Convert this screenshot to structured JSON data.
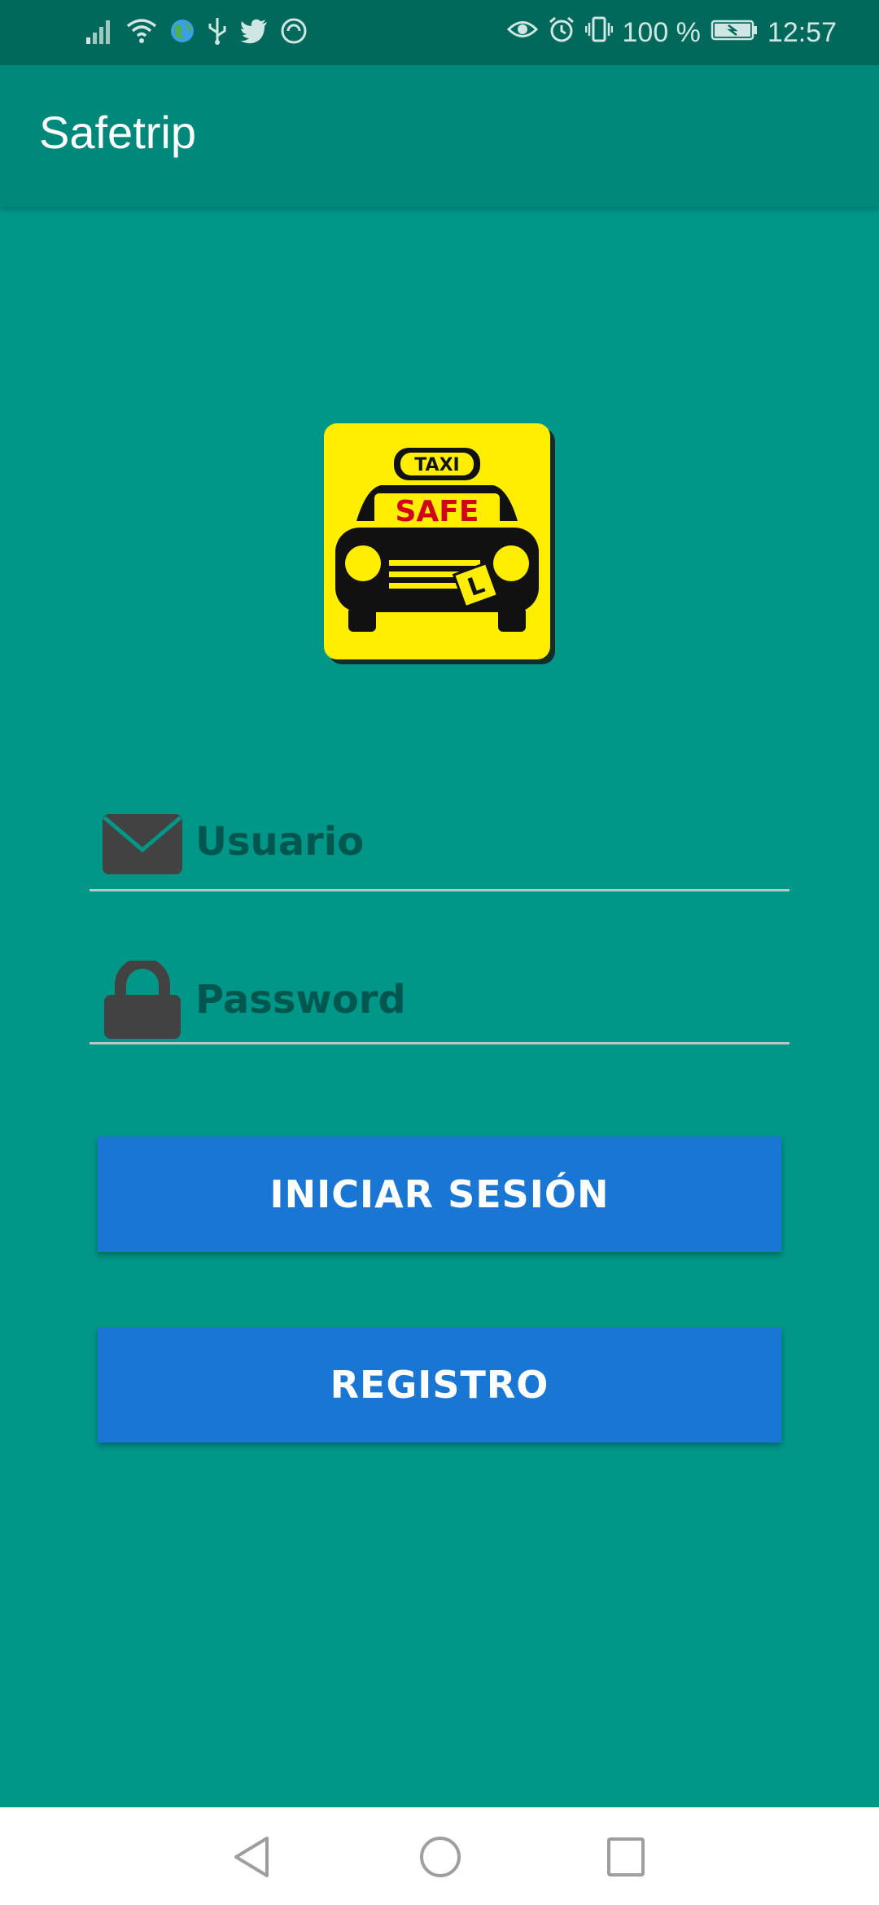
{
  "status_bar": {
    "battery": "100 %",
    "time": "12:57",
    "left_icons": [
      "signal-icon",
      "wifi-icon",
      "globe-icon",
      "usb-icon",
      "twitter-icon",
      "sync-icon"
    ],
    "right_icons": [
      "eye-icon",
      "alarm-icon",
      "vibrate-icon",
      "battery-icon"
    ]
  },
  "app_bar": {
    "title": "Safetrip"
  },
  "logo": {
    "top_text": "TAXI",
    "main_text": "SAFE",
    "badge_text": "L",
    "bg_color": "#ffee00",
    "accent_color": "#d0021b"
  },
  "form": {
    "username_placeholder": "Usuario",
    "password_placeholder": "Password"
  },
  "buttons": {
    "login_label": "INICIAR SESIÓN",
    "register_label": "REGISTRO"
  },
  "colors": {
    "primary_dark": "#00695c",
    "primary": "#00897b",
    "background": "#009688",
    "button": "#1976d2"
  },
  "nav_bar": {
    "icons": [
      "back-icon",
      "home-icon",
      "recents-icon"
    ]
  }
}
